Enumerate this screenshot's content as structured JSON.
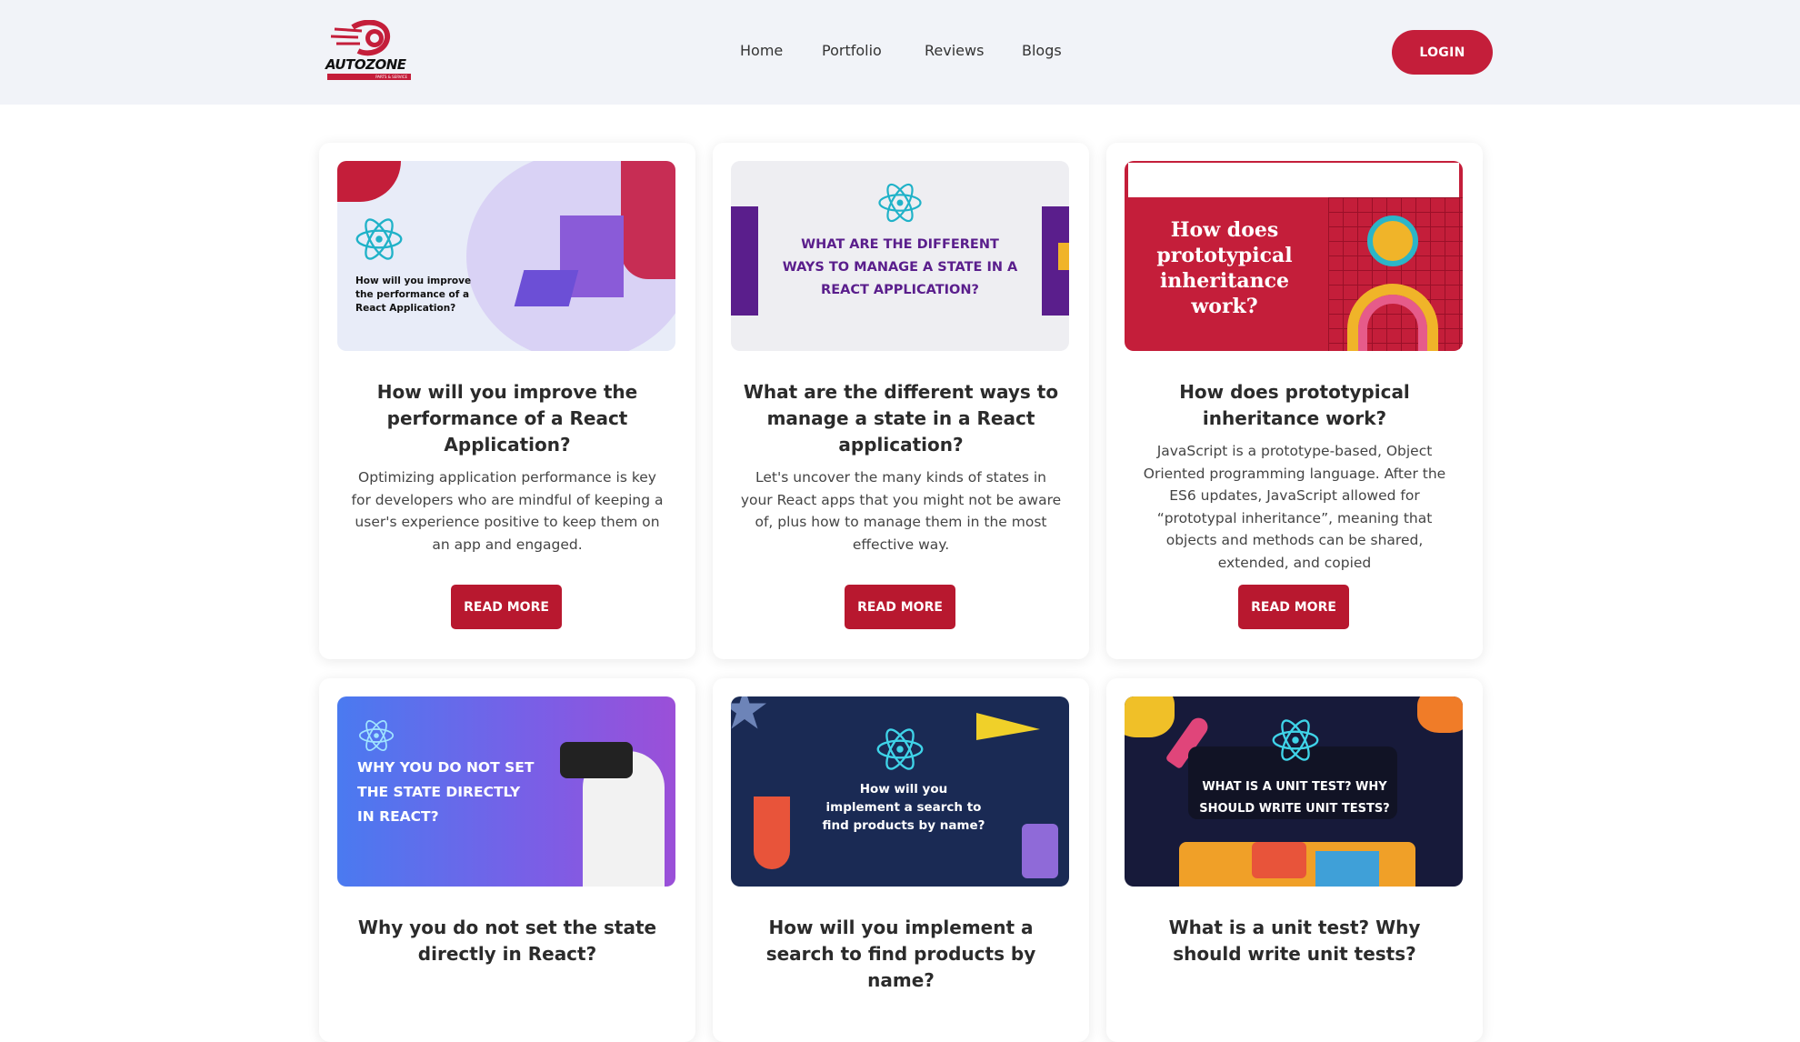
{
  "brand": {
    "name": "AUTOZONE",
    "tagline": "PARTS & SERVICE",
    "accent": "#c41e3a"
  },
  "nav": {
    "items": [
      "Home",
      "Portfolio",
      "Reviews",
      "Blogs"
    ],
    "login": "LOGIN"
  },
  "cards": [
    {
      "thumb_text": "How will you improve the performance of a React Application?",
      "title": "How will you improve the performance of a React Application?",
      "description": "Optimizing application performance is key for developers who are mindful of keeping a user's experience positive to keep them on an app and engaged.",
      "cta": "READ MORE"
    },
    {
      "thumb_text": "WHAT ARE THE DIFFERENT WAYS TO MANAGE A STATE IN A REACT APPLICATION?",
      "title": "What are the different ways to manage a state in a React application?",
      "description": "Let's uncover the many kinds of states in your React apps that you might not be aware of, plus how to manage them in the most effective way.",
      "cta": "READ MORE"
    },
    {
      "thumb_text": "How does prototypical inheritance work?",
      "title": "How does prototypical inheritance work?",
      "description": "JavaScript is a prototype-based, Object Oriented programming language. After the ES6 updates, JavaScript allowed for “prototypal inheritance”, meaning that objects and methods can be shared, extended, and copied",
      "cta": "READ MORE"
    },
    {
      "thumb_text": "WHY YOU DO NOT SET THE STATE DIRECTLY IN REACT?",
      "title": "Why you do not set the state directly in React?"
    },
    {
      "thumb_text": "How will you implement a search to find products by name?",
      "title": "How will you implement a search to find products by name?"
    },
    {
      "thumb_text": "WHAT IS A UNIT TEST? WHY SHOULD WRITE UNIT TESTS?",
      "title": "What is a unit test? Why should write unit tests?"
    }
  ]
}
